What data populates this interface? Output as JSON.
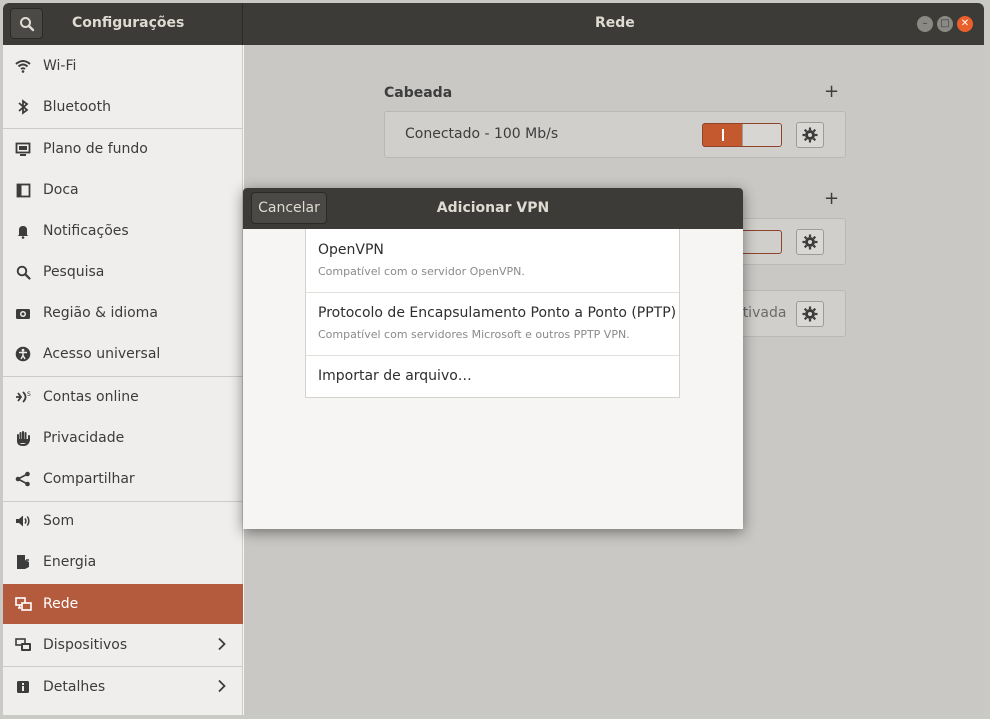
{
  "header": {
    "app_title": "Configurações",
    "page_title": "Rede"
  },
  "sidebar": {
    "items": [
      {
        "label": "Wi-Fi",
        "icon": "wifi-icon"
      },
      {
        "label": "Bluetooth",
        "icon": "bluetooth-icon"
      },
      {
        "label": "Plano de fundo",
        "icon": "background-icon"
      },
      {
        "label": "Doca",
        "icon": "dock-icon"
      },
      {
        "label": "Notificações",
        "icon": "bell-icon"
      },
      {
        "label": "Pesquisa",
        "icon": "search-icon"
      },
      {
        "label": "Região & idioma",
        "icon": "camera-icon"
      },
      {
        "label": "Acesso universal",
        "icon": "accessibility-icon"
      },
      {
        "label": "Contas online",
        "icon": "online-accounts-icon"
      },
      {
        "label": "Privacidade",
        "icon": "hand-icon"
      },
      {
        "label": "Compartilhar",
        "icon": "share-icon"
      },
      {
        "label": "Som",
        "icon": "speaker-icon"
      },
      {
        "label": "Energia",
        "icon": "power-icon"
      },
      {
        "label": "Rede",
        "icon": "network-icon",
        "active": true
      },
      {
        "label": "Dispositivos",
        "icon": "devices-icon"
      },
      {
        "label": "Detalhes",
        "icon": "info-icon"
      }
    ]
  },
  "content": {
    "wired_title": "Cabeada",
    "wired_status": "Conectado - 100 Mb/s",
    "proxy_partial": "ctivada"
  },
  "dialog": {
    "cancel_label": "Cancelar",
    "title": "Adicionar VPN",
    "options": [
      {
        "title": "OpenVPN",
        "subtitle": "Compatível com o servidor OpenVPN."
      },
      {
        "title": "Protocolo de Encapsulamento Ponto a Ponto (PPTP)",
        "subtitle": "Compatível com servidores Microsoft e outros PPTP VPN."
      },
      {
        "title": "Importar de arquivo…"
      }
    ]
  },
  "colors": {
    "accent": "#b45b3d",
    "switch_on": "#c4582f",
    "headerbar": "#3c3b37"
  }
}
